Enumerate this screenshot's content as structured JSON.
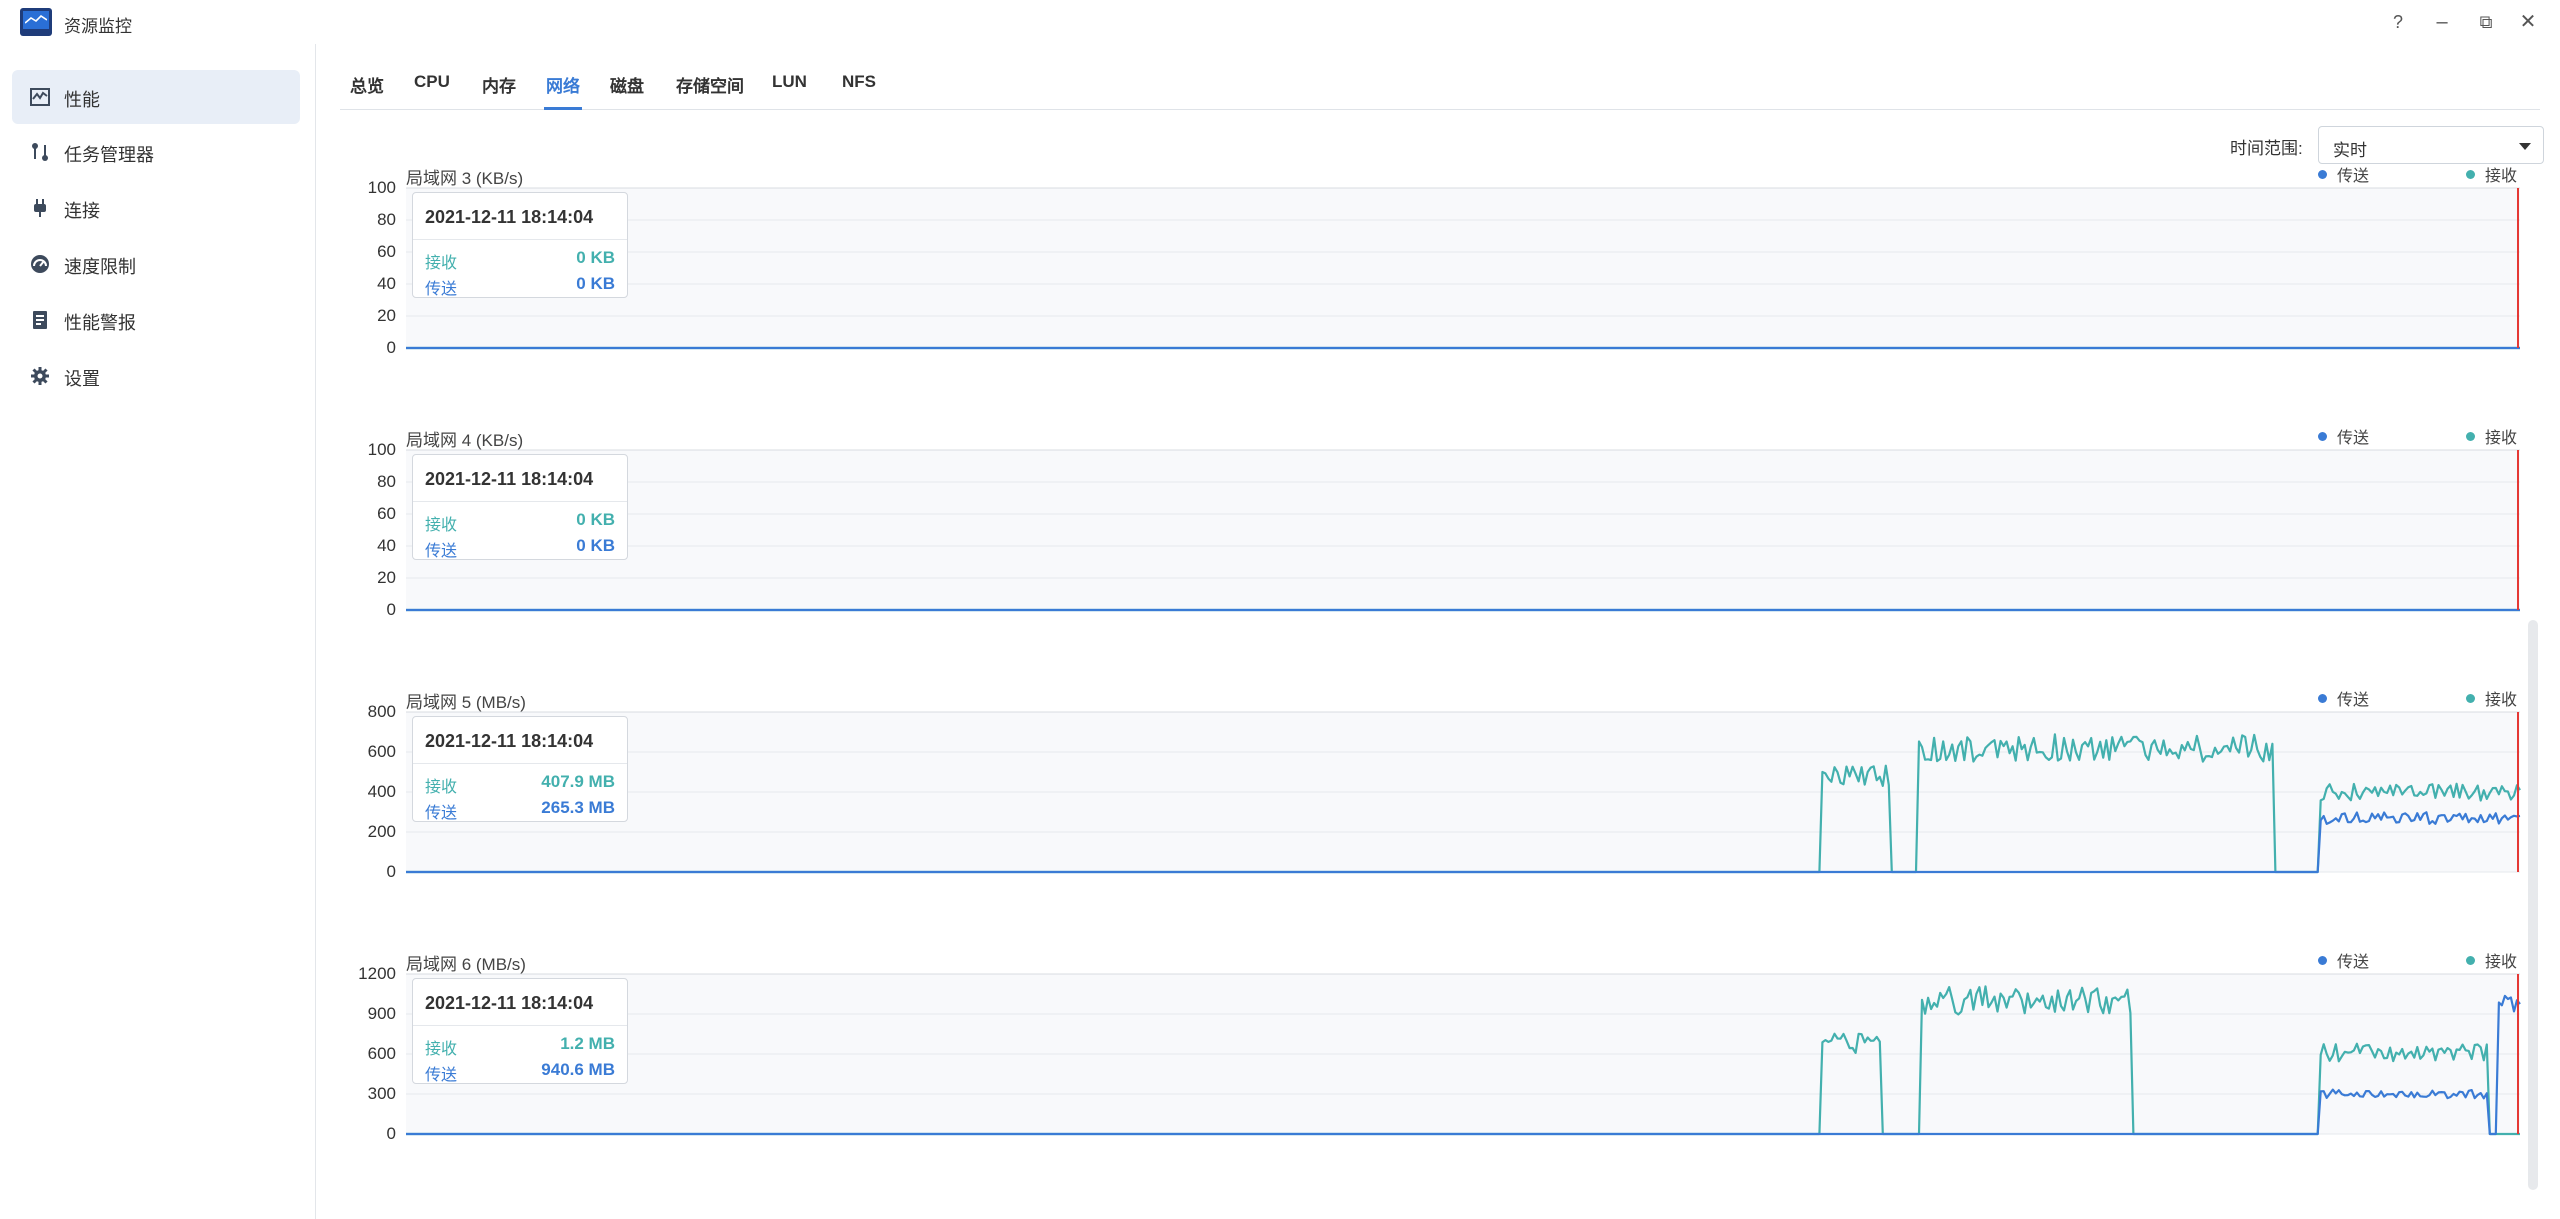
{
  "window": {
    "title": "资源监控",
    "buttons": [
      "?",
      "–",
      "⧉",
      "✕"
    ]
  },
  "colors": {
    "send": "#3a7bd5",
    "receive": "#43b0ae",
    "cursor": "#e53935",
    "active_bg": "#e8eef7"
  },
  "sidebar": {
    "items": [
      {
        "label": "性能",
        "icon": "performance-chart-icon"
      },
      {
        "label": "任务管理器",
        "icon": "task-manager-icon"
      },
      {
        "label": "连接",
        "icon": "plug-icon"
      },
      {
        "label": "速度限制",
        "icon": "speed-gauge-icon"
      },
      {
        "label": "性能警报",
        "icon": "report-icon"
      },
      {
        "label": "设置",
        "icon": "gear-icon"
      }
    ]
  },
  "tabs": [
    "总览",
    "CPU",
    "内存",
    "网络",
    "磁盘",
    "存储空间",
    "LUN",
    "NFS"
  ],
  "time_range": {
    "label": "时间范围:",
    "value": "实时"
  },
  "legend": {
    "send": "传送",
    "receive": "接收"
  },
  "chart_data": [
    {
      "type": "line",
      "title": "局域网 3 (KB/s)",
      "ylim": [
        0,
        100
      ],
      "yticks": [
        "100",
        "80",
        "60",
        "40",
        "20",
        "0"
      ],
      "tooltip": {
        "time": "2021-12-11 18:14:04",
        "receive_label": "接收",
        "receive": "0 KB",
        "send_label": "传送",
        "send": "0 KB"
      },
      "series": [
        {
          "name": "接收",
          "segments": [
            [
              0,
              0
            ]
          ]
        },
        {
          "name": "传送",
          "segments": [
            [
              0,
              0
            ]
          ]
        }
      ]
    },
    {
      "type": "line",
      "title": "局域网 4 (KB/s)",
      "ylim": [
        0,
        100
      ],
      "yticks": [
        "100",
        "80",
        "60",
        "40",
        "20",
        "0"
      ],
      "tooltip": {
        "time": "2021-12-11 18:14:04",
        "receive_label": "接收",
        "receive": "0 KB",
        "send_label": "传送",
        "send": "0 KB"
      },
      "series": [
        {
          "name": "接收",
          "segments": [
            [
              0,
              0
            ]
          ]
        },
        {
          "name": "传送",
          "segments": [
            [
              0,
              0
            ]
          ]
        }
      ]
    },
    {
      "type": "line",
      "title": "局域网 5 (MB/s)",
      "ylim": [
        0,
        800
      ],
      "yticks": [
        "800",
        "600",
        "400",
        "200",
        "0"
      ],
      "tooltip": {
        "time": "2021-12-11 18:14:04",
        "receive_label": "接收",
        "receive": "407.9 MB",
        "send_label": "传送",
        "send": "265.3 MB"
      },
      "series": [
        {
          "name": "接收",
          "blocks": [
            [
              0.669,
              0.702,
              480
            ],
            [
              0.715,
              0.883,
              620
            ],
            [
              0.905,
              1.0,
              400
            ]
          ]
        },
        {
          "name": "传送",
          "blocks": [
            [
              0.905,
              1.0,
              270
            ]
          ]
        }
      ]
    },
    {
      "type": "line",
      "title": "局域网 6 (MB/s)",
      "ylim": [
        0,
        1200
      ],
      "yticks": [
        "1200",
        "900",
        "600",
        "300",
        "0"
      ],
      "tooltip": {
        "time": "2021-12-11 18:14:04",
        "receive_label": "接收",
        "receive": "1.2 MB",
        "send_label": "传送",
        "send": "940.6 MB"
      },
      "series": [
        {
          "name": "接收",
          "blocks": [
            [
              0.67,
              0.698,
              680
            ],
            [
              0.717,
              0.817,
              1000
            ],
            [
              0.905,
              0.985,
              610
            ]
          ]
        },
        {
          "name": "传送",
          "blocks": [
            [
              0.905,
              0.985,
              300
            ],
            [
              0.99,
              1.0,
              950
            ]
          ]
        }
      ]
    }
  ]
}
